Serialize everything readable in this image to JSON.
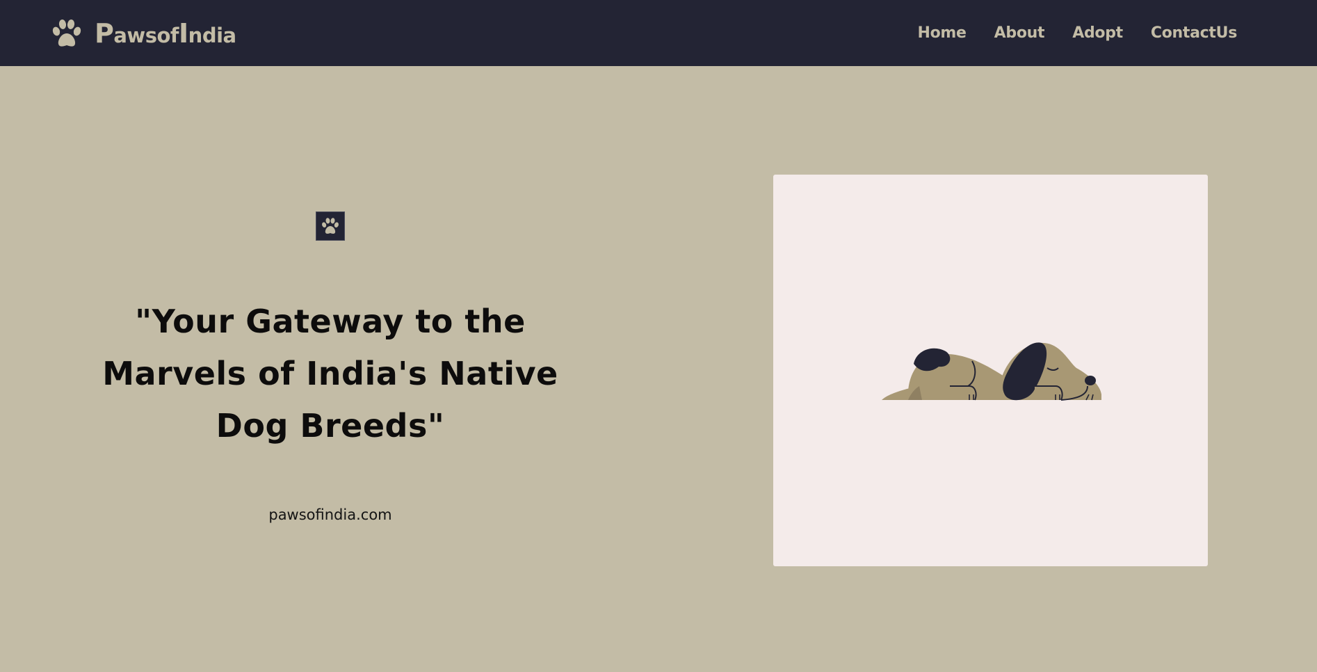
{
  "navbar": {
    "brand_icon": "paw-icon",
    "brand_first": "P",
    "brand_rest": "awsof",
    "brand_second": "I",
    "brand_end": "ndia",
    "links": [
      {
        "label": "Home"
      },
      {
        "label": "About"
      },
      {
        "label": "Adopt"
      },
      {
        "label": "ContactUs"
      }
    ]
  },
  "hero": {
    "badge_icon": "paw-icon",
    "headline": "\"Your Gateway to the Marvels of India's Native Dog Breeds\"",
    "url": "pawsofindia.com",
    "image_subject": "sleeping-dog-illustration"
  },
  "colors": {
    "nav_bg": "#232434",
    "page_bg": "#c3bca6",
    "accent": "#c3bca6",
    "card_bg": "#f4ebea",
    "dog_body": "#a89874",
    "dog_spots": "#232434"
  }
}
